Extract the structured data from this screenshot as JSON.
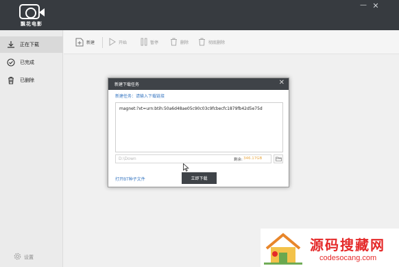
{
  "app": {
    "logo_text": "飘花电影"
  },
  "window_controls": {
    "minimize": "—",
    "close": "✕"
  },
  "sidebar": {
    "items": [
      {
        "label": "正在下载",
        "icon": "download-icon",
        "active": true
      },
      {
        "label": "已完成",
        "icon": "check-circle-icon",
        "active": false
      },
      {
        "label": "已删除",
        "icon": "trash-icon",
        "active": false
      }
    ],
    "settings_label": "设置"
  },
  "toolbar": {
    "new_label": "新建",
    "start_label": "开始",
    "pause_label": "暂停",
    "delete_label": "删除",
    "thorough_delete_label": "彻底删除"
  },
  "dialog": {
    "title": "新建下载任务",
    "close": "✕",
    "hint": "新建任务：请输入下载链接",
    "magnet_link": "magnet:?xt=urn:btih:50a6d48ae05c90c03c9fcbecfc1879fb42d5e75d",
    "path_placeholder": "D:\\Down",
    "space_label": "剩余:",
    "space_value": "346.17GB",
    "open_torrent": "打开BT种子文件",
    "start_download": "立即下载"
  },
  "watermark": {
    "title": "源码搜藏网",
    "url": "codesocang.com"
  },
  "colors": {
    "titlebar": "#373b40",
    "dialog_header": "#3f4348",
    "link": "#3a78c2",
    "space_value": "#e8a845",
    "watermark": "#e52a2a"
  }
}
